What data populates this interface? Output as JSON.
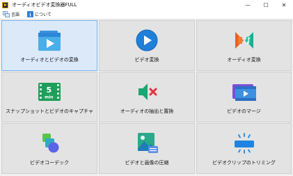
{
  "window": {
    "title": "オーディオビデオ変換器FULL",
    "minimize": "—",
    "maximize": "☐",
    "close": "✕"
  },
  "menu": {
    "items": [
      {
        "label": "言語",
        "icon": "language-icon"
      },
      {
        "label": "について",
        "icon": "info-icon"
      }
    ]
  },
  "tiles": [
    {
      "label": "オーディオとビデオの変換",
      "icon": "video-folder-play-icon",
      "selected": true
    },
    {
      "label": "ビデオ変換",
      "icon": "play-circle-icon"
    },
    {
      "label": "オーディオ変換",
      "icon": "audio-convert-icon"
    },
    {
      "label": "スナップショットとビデオのキャプチャ",
      "icon": "film-5min-icon"
    },
    {
      "label": "オーディオの抽出と置換",
      "icon": "speaker-mute-icon"
    },
    {
      "label": "ビデオのマージ",
      "icon": "video-merge-icon"
    },
    {
      "label": "ビデオコーデック",
      "icon": "codec-shapes-icon"
    },
    {
      "label": "ビデオと画像の圧縮",
      "icon": "image-compress-icon"
    },
    {
      "label": "ビデオクリップのトリミング",
      "icon": "video-trim-icon"
    }
  ]
}
